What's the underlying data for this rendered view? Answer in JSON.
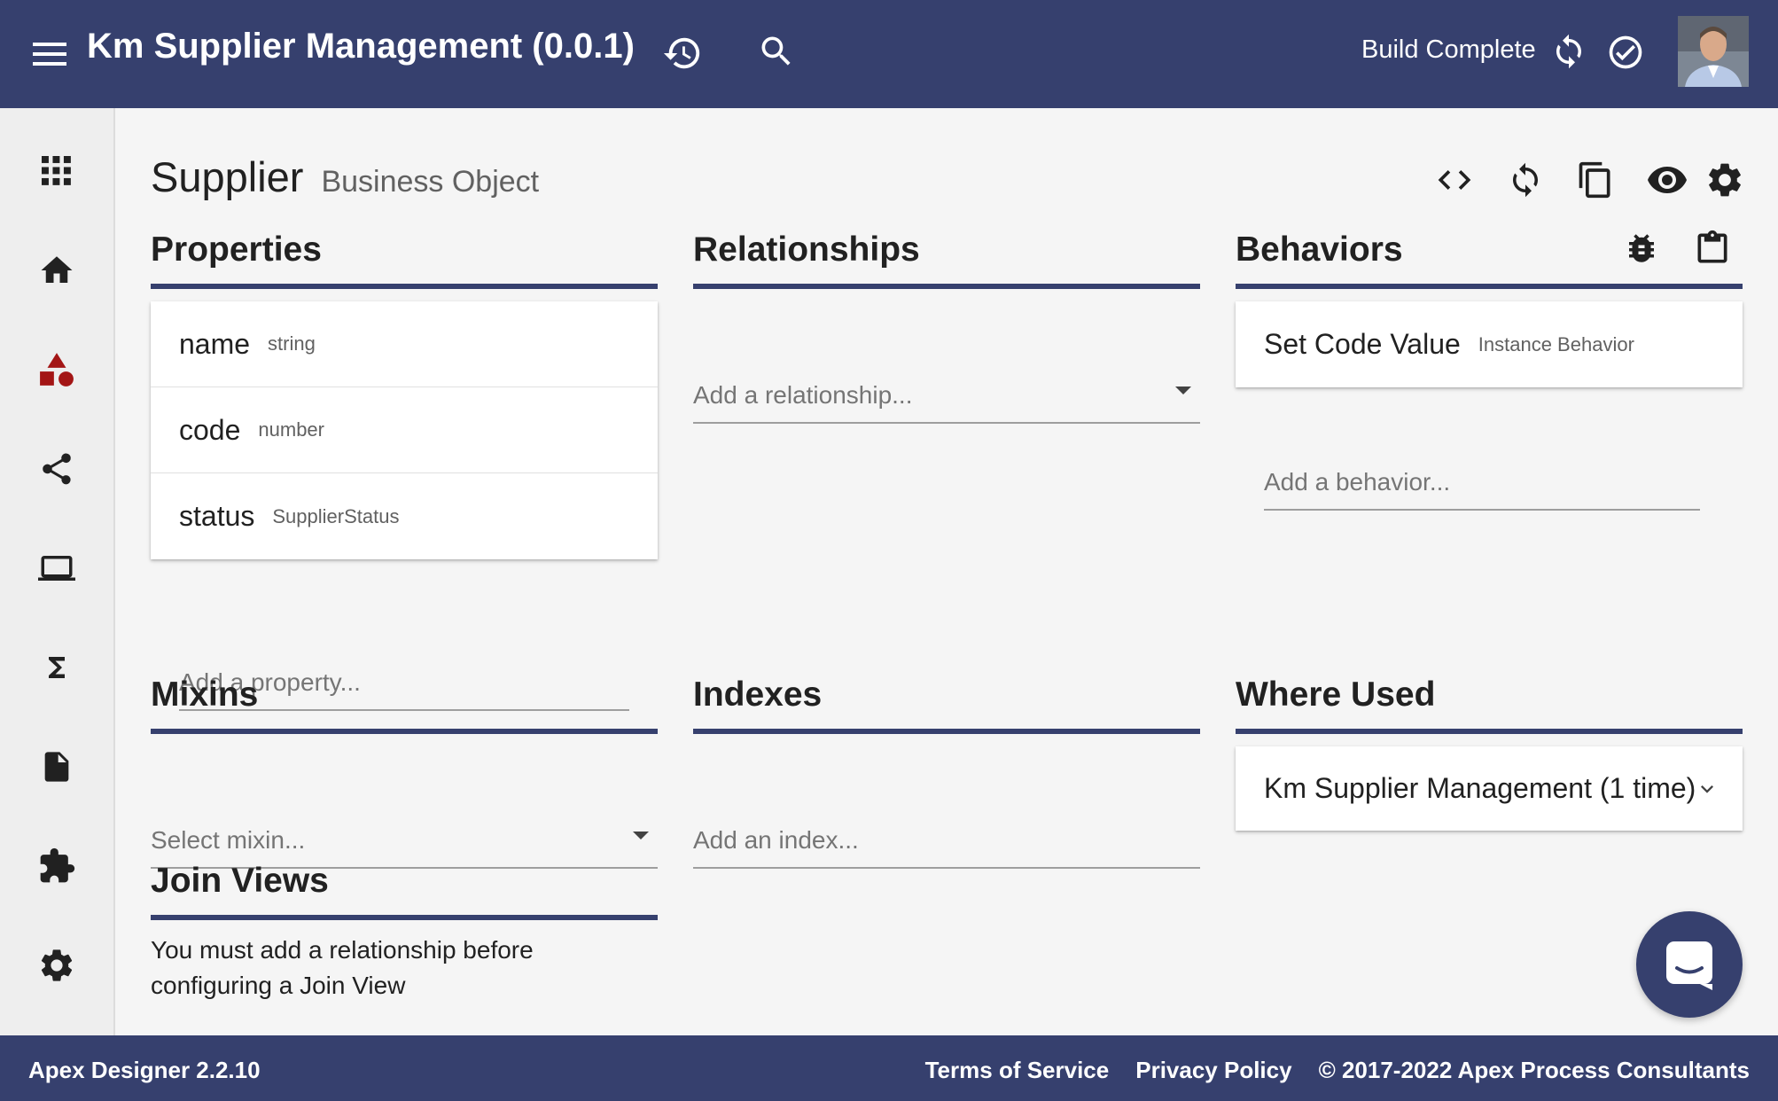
{
  "header": {
    "title": "Km Supplier Management (0.0.1)",
    "build_status": "Build Complete",
    "icons": [
      "menu-icon",
      "history-icon",
      "search-icon",
      "sync-icon",
      "check-circle-icon",
      "user-avatar"
    ]
  },
  "sidebar": {
    "items": [
      {
        "icon": "apps-grid-icon"
      },
      {
        "icon": "home-icon"
      },
      {
        "icon": "shapes-icon"
      },
      {
        "icon": "share-icon"
      },
      {
        "icon": "laptop-icon"
      },
      {
        "icon": "sigma-icon"
      },
      {
        "icon": "document-icon"
      },
      {
        "icon": "puzzle-icon"
      },
      {
        "icon": "settings-icon"
      }
    ]
  },
  "page": {
    "title": "Supplier",
    "subtitle": "Business Object",
    "actions": [
      "code-icon",
      "refresh-icon",
      "copy-icon",
      "eye-icon",
      "gear-icon"
    ]
  },
  "properties": {
    "title": "Properties",
    "items": [
      {
        "name": "name",
        "type": "string"
      },
      {
        "name": "code",
        "type": "number"
      },
      {
        "name": "status",
        "type": "SupplierStatus"
      }
    ],
    "add_placeholder": "Add a property..."
  },
  "relationships": {
    "title": "Relationships",
    "add_placeholder": "Add a relationship..."
  },
  "behaviors": {
    "title": "Behaviors",
    "items": [
      {
        "name": "Set Code Value",
        "type": "Instance Behavior"
      }
    ],
    "add_placeholder": "Add a behavior..."
  },
  "mixins": {
    "title": "Mixins",
    "select_placeholder": "Select mixin..."
  },
  "indexes": {
    "title": "Indexes",
    "add_placeholder": "Add an index..."
  },
  "where_used": {
    "title": "Where Used",
    "items": [
      {
        "label": "Km Supplier Management (1 time)"
      }
    ]
  },
  "join_views": {
    "title": "Join Views",
    "message": "You must add a relationship before configuring a Join View"
  },
  "footer": {
    "version": "Apex Designer 2.2.10",
    "terms": "Terms of Service",
    "privacy": "Privacy Policy",
    "copyright": "© 2017-2022 Apex Process Consultants"
  },
  "colors": {
    "primary": "#36406e",
    "accent_red": "#a31515",
    "background": "#f5f5f5"
  }
}
